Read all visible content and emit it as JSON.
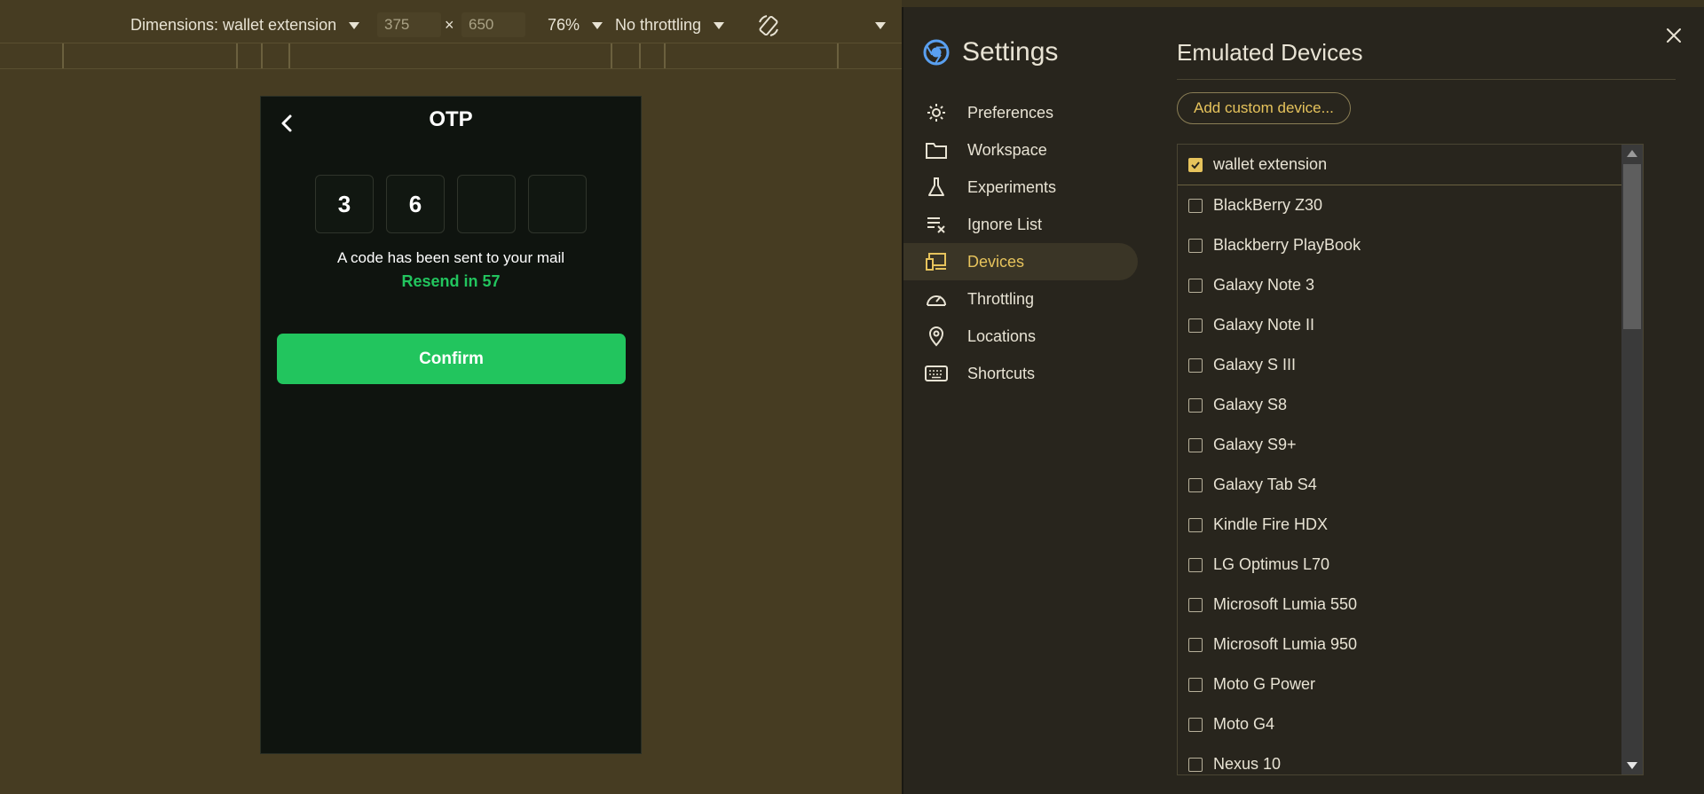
{
  "toolbar": {
    "dimensions_label": "Dimensions: wallet extension",
    "width": "375",
    "times": "×",
    "height": "650",
    "zoom": "76%",
    "throttling": "No throttling"
  },
  "otp_screen": {
    "title": "OTP",
    "digits": [
      "3",
      "6",
      "",
      ""
    ],
    "sent_text": "A code has been sent to your mail",
    "resend_text": "Resend in 57",
    "confirm_label": "Confirm",
    "accent_color": "#22c55e"
  },
  "settings": {
    "title": "Settings",
    "nav": [
      {
        "label": "Preferences",
        "icon": "gear-icon"
      },
      {
        "label": "Workspace",
        "icon": "folder-icon"
      },
      {
        "label": "Experiments",
        "icon": "flask-icon"
      },
      {
        "label": "Ignore List",
        "icon": "ignore-list-icon"
      },
      {
        "label": "Devices",
        "icon": "devices-icon",
        "active": true
      },
      {
        "label": "Throttling",
        "icon": "speedometer-icon"
      },
      {
        "label": "Locations",
        "icon": "location-pin-icon"
      },
      {
        "label": "Shortcuts",
        "icon": "keyboard-icon"
      }
    ],
    "accent_color": "#e6c35c"
  },
  "emulated_devices": {
    "title": "Emulated Devices",
    "add_button": "Add custom device...",
    "devices": [
      {
        "name": "wallet extension",
        "checked": true
      },
      {
        "name": "BlackBerry Z30",
        "checked": false
      },
      {
        "name": "Blackberry PlayBook",
        "checked": false
      },
      {
        "name": "Galaxy Note 3",
        "checked": false
      },
      {
        "name": "Galaxy Note II",
        "checked": false
      },
      {
        "name": "Galaxy S III",
        "checked": false
      },
      {
        "name": "Galaxy S8",
        "checked": false
      },
      {
        "name": "Galaxy S9+",
        "checked": false
      },
      {
        "name": "Galaxy Tab S4",
        "checked": false
      },
      {
        "name": "Kindle Fire HDX",
        "checked": false
      },
      {
        "name": "LG Optimus L70",
        "checked": false
      },
      {
        "name": "Microsoft Lumia 550",
        "checked": false
      },
      {
        "name": "Microsoft Lumia 950",
        "checked": false
      },
      {
        "name": "Moto G Power",
        "checked": false
      },
      {
        "name": "Moto G4",
        "checked": false
      },
      {
        "name": "Nexus 10",
        "checked": false
      }
    ]
  }
}
